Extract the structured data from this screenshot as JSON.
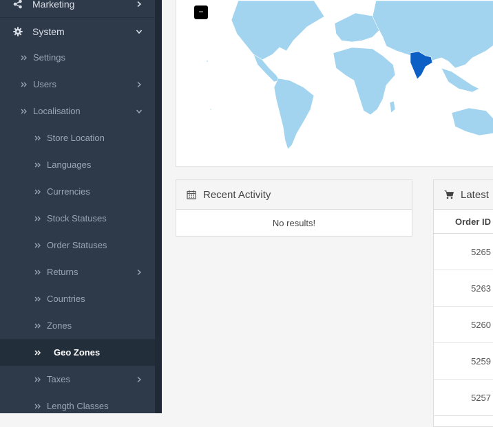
{
  "sidebar": {
    "items": [
      {
        "label": "Marketing",
        "icon": "share-icon",
        "level": 1,
        "caret": "right"
      },
      {
        "label": "System",
        "icon": "gear-icon",
        "level": 1,
        "caret": "down"
      },
      {
        "label": "Settings",
        "level": 2,
        "caret": null
      },
      {
        "label": "Users",
        "level": 2,
        "caret": "right"
      },
      {
        "label": "Localisation",
        "level": 2,
        "caret": "down"
      },
      {
        "label": "Store Location",
        "level": 3,
        "caret": null
      },
      {
        "label": "Languages",
        "level": 3,
        "caret": null
      },
      {
        "label": "Currencies",
        "level": 3,
        "caret": null
      },
      {
        "label": "Stock Statuses",
        "level": 3,
        "caret": null
      },
      {
        "label": "Order Statuses",
        "level": 3,
        "caret": null
      },
      {
        "label": "Returns",
        "level": 3,
        "caret": "right"
      },
      {
        "label": "Countries",
        "level": 3,
        "caret": null
      },
      {
        "label": "Zones",
        "level": 3,
        "caret": null
      },
      {
        "label": "Geo Zones",
        "level": 3,
        "caret": null,
        "active": true
      },
      {
        "label": "Taxes",
        "level": 3,
        "caret": "right"
      },
      {
        "label": "Length Classes",
        "level": 3,
        "caret": null
      }
    ]
  },
  "map": {
    "zoom_out_label": "−",
    "highlight_color": "#0b5fc5",
    "land_color": "#a3d4ef"
  },
  "recent_activity": {
    "title": "Recent Activity",
    "empty_text": "No results!"
  },
  "latest_orders": {
    "title": "Latest",
    "column_header": "Order ID",
    "order_ids": [
      "5265",
      "5263",
      "5260",
      "5259",
      "5257"
    ]
  },
  "colors": {
    "sidebar_bg": "#2e3a4a",
    "active_bg": "#232e3b"
  }
}
